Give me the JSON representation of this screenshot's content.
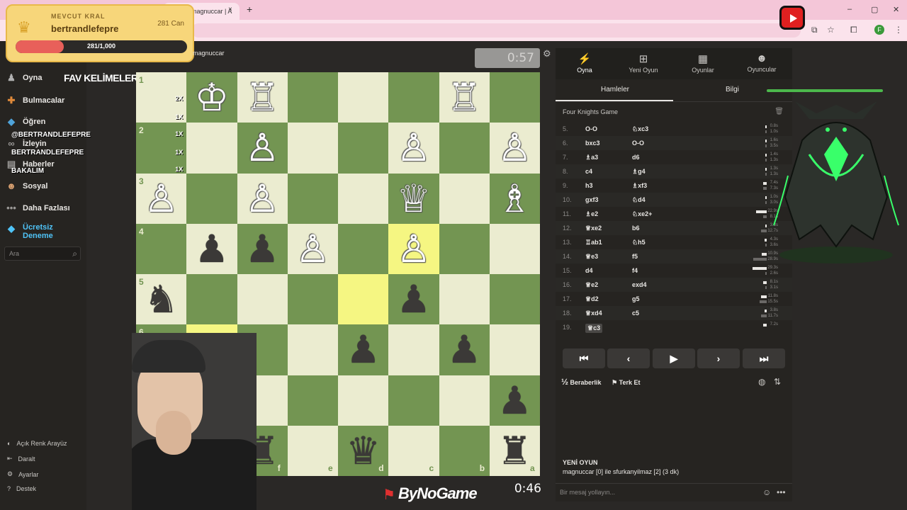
{
  "browser": {
    "tab_title": "magnuccar | A",
    "tab_close": "×",
    "new_tab": "+",
    "win_min": "–",
    "win_max": "▢",
    "win_close": "✕",
    "profile_initial": "F"
  },
  "king_card": {
    "label": "MEVCUT KRAL",
    "name": "bertrandlefepre",
    "hp": "281 Can",
    "bar_text": "281/1,000",
    "bar_fraction": 0.281
  },
  "overlay": {
    "fav_title": "FAV KELİMELER",
    "handle1": "@BERTRANDLEFEPRE",
    "handle2": "BERTRANDLEFEPRE",
    "handle3": "BAKALIM"
  },
  "sidebar": {
    "items": [
      {
        "label": "Oyna",
        "icon": "pawn-icon"
      },
      {
        "label": "Bulmacalar",
        "icon": "puzzle-icon"
      },
      {
        "label": "Öğren",
        "icon": "learn-icon"
      },
      {
        "label": "İzleyin",
        "icon": "binoculars-icon"
      },
      {
        "label": "Haberler",
        "icon": "news-icon"
      },
      {
        "label": "Sosyal",
        "icon": "people-icon"
      },
      {
        "label": "Daha Fazlası",
        "icon": "more-icon"
      },
      {
        "label": "Ücretsiz Deneme",
        "icon": "diamond-icon"
      }
    ],
    "search_placeholder": "Ara",
    "bottom": [
      {
        "label": "Açık Renk Arayüz",
        "icon": "theme-icon"
      },
      {
        "label": "Daralt",
        "icon": "collapse-icon"
      },
      {
        "label": "Ayarlar",
        "icon": "gear-icon"
      },
      {
        "label": "Destek",
        "icon": "help-icon"
      }
    ]
  },
  "game": {
    "opponent_name": "magnuccar",
    "opponent_clock": "0:57",
    "my_clock": "0:46",
    "brand": "ByNoGame",
    "rank_labels": [
      "1",
      "2",
      "3",
      "4",
      "5",
      "6"
    ],
    "file_labels": [
      "f",
      "e",
      "d",
      "c",
      "b",
      "a"
    ],
    "multipliers": [
      "2X",
      "1X",
      "1X",
      "1X",
      "1X"
    ]
  },
  "right_panel": {
    "tabs": [
      {
        "label": "Oyna",
        "icon": "bolt-icon"
      },
      {
        "label": "Yeni Oyun",
        "icon": "plus-icon"
      },
      {
        "label": "Oyunlar",
        "icon": "board-icon"
      },
      {
        "label": "Oyuncular",
        "icon": "players-icon"
      }
    ],
    "subtabs": [
      "Hamleler",
      "Bilgi"
    ],
    "opening": "Four Knights Game",
    "moves": [
      {
        "n": "5.",
        "w": "O-O",
        "b": "♘xc3",
        "tw": 0.8,
        "tb": 1.0
      },
      {
        "n": "6.",
        "w": "bxc3",
        "b": "O-O",
        "tw": 1.6,
        "tb": 3.5
      },
      {
        "n": "7.",
        "w": "♗a3",
        "b": "d6",
        "tw": 1.4,
        "tb": 1.3
      },
      {
        "n": "8.",
        "w": "c4",
        "b": "♗g4",
        "tw": 1.3,
        "tb": 1.3
      },
      {
        "n": "9.",
        "w": "h3",
        "b": "♗xf3",
        "tw": 7.4,
        "tb": 7.3
      },
      {
        "n": "10.",
        "w": "gxf3",
        "b": "♘d4",
        "tw": 1.0,
        "tb": 3.0
      },
      {
        "n": "11.",
        "w": "♗e2",
        "b": "♘xe2+",
        "tw": 22.9,
        "tb": 8.1
      },
      {
        "n": "12.",
        "w": "♕xe2",
        "b": "b6",
        "tw": 3.3,
        "tb": 12.7
      },
      {
        "n": "13.",
        "w": "♖ab1",
        "b": "♘h5",
        "tw": 4.3,
        "tb": 3.6
      },
      {
        "n": "14.",
        "w": "♕e3",
        "b": "f5",
        "tw": 10.9,
        "tb": 28.9
      },
      {
        "n": "15.",
        "w": "d4",
        "b": "f4",
        "tw": 29.3,
        "tb": 2.6
      },
      {
        "n": "16.",
        "w": "♕e2",
        "b": "exd4",
        "tw": 8.1,
        "tb": 3.1
      },
      {
        "n": "17.",
        "w": "♕d2",
        "b": "g5",
        "tw": 11.8,
        "tb": 15.5
      },
      {
        "n": "18.",
        "w": "♕xd4",
        "b": "c5",
        "tw": 3.8,
        "tb": 11.7
      },
      {
        "n": "19.",
        "w": "♕c3",
        "b": "",
        "tw": 7.2,
        "tb": 0
      }
    ],
    "time_labels_w": [
      "0.8s",
      "1.6s",
      "1.4s",
      "1.3s",
      "7.4s",
      "1.0s",
      "22.9s",
      "3.3s",
      "4.3s",
      "10.9s",
      "29.3s",
      "8.1s",
      "11.8s",
      "3.8s",
      "7.2s"
    ],
    "time_labels_b": [
      "1.0s",
      "3.5s",
      "1.3s",
      "1.3s",
      "7.3s",
      "3.0s",
      "8.1s",
      "12.7s",
      "3.6s",
      "28.9s",
      "2.6s",
      "3.1s",
      "15.5s",
      "11.7s",
      ""
    ],
    "controls": [
      "⏮",
      "‹",
      "▶",
      "›",
      "⏭"
    ],
    "draw": "Beraberlik",
    "resign": "Terk Et",
    "draw_icon": "½",
    "new_game_title": "YENİ OYUN",
    "new_game_text": "magnuccar [0] ile sfurkanyilmaz [2] (3 dk)",
    "chat_placeholder": "Bir mesaj yollayın..."
  },
  "colors": {
    "board_light": "#ebecd0",
    "board_dark": "#739552",
    "highlight": "#b9ca43",
    "king_card": "#f7d67a",
    "accent_green": "#4cb84c"
  }
}
